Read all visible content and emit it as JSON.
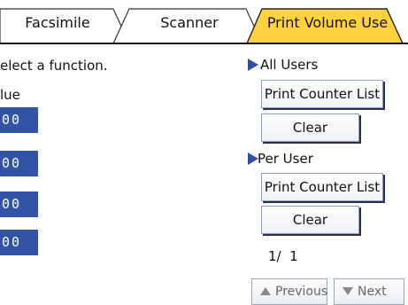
{
  "tabs": [
    {
      "label": "Facsimile",
      "active": false
    },
    {
      "label": "Scanner",
      "active": false
    },
    {
      "label": "Print Volume Use",
      "active": true
    }
  ],
  "instruction": "elect a function.",
  "column_header": "lue",
  "value_rows": [
    "00",
    "00",
    "00",
    "00"
  ],
  "all_users": {
    "heading": "All Users",
    "print_counter_list": "Print Counter List",
    "clear": "Clear"
  },
  "per_user": {
    "heading": "Per User",
    "print_counter_list": "Print Counter List",
    "clear": "Clear"
  },
  "pagination": {
    "page_indicator": "1/  1",
    "previous": "Previous",
    "next": "Next"
  },
  "colors": {
    "active_tab": "#ffd23f",
    "value_box": "#3353a6",
    "arrow": "#2f4fa8"
  }
}
